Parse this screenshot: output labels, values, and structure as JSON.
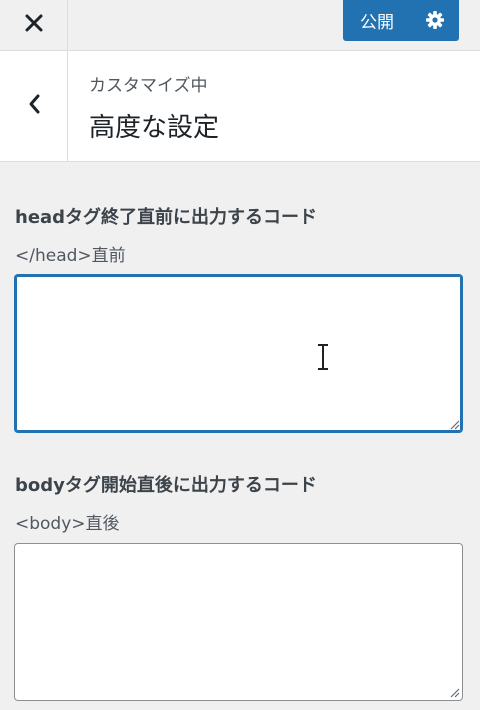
{
  "topbar": {
    "close_icon": "close-icon",
    "publish_label": "公開",
    "settings_icon": "gear-icon"
  },
  "header": {
    "back_icon": "chevron-left-icon",
    "breadcrumb": "カスタマイズ中",
    "title": "高度な設定"
  },
  "sections": [
    {
      "title": "headタグ終了直前に出力するコード",
      "description": "</head>直前",
      "value": ""
    },
    {
      "title": "bodyタグ開始直後に出力するコード",
      "description": "<body>直後",
      "value": ""
    }
  ],
  "colors": {
    "accent": "#2271b1",
    "background": "#f0f0f1",
    "panel": "#ffffff"
  }
}
